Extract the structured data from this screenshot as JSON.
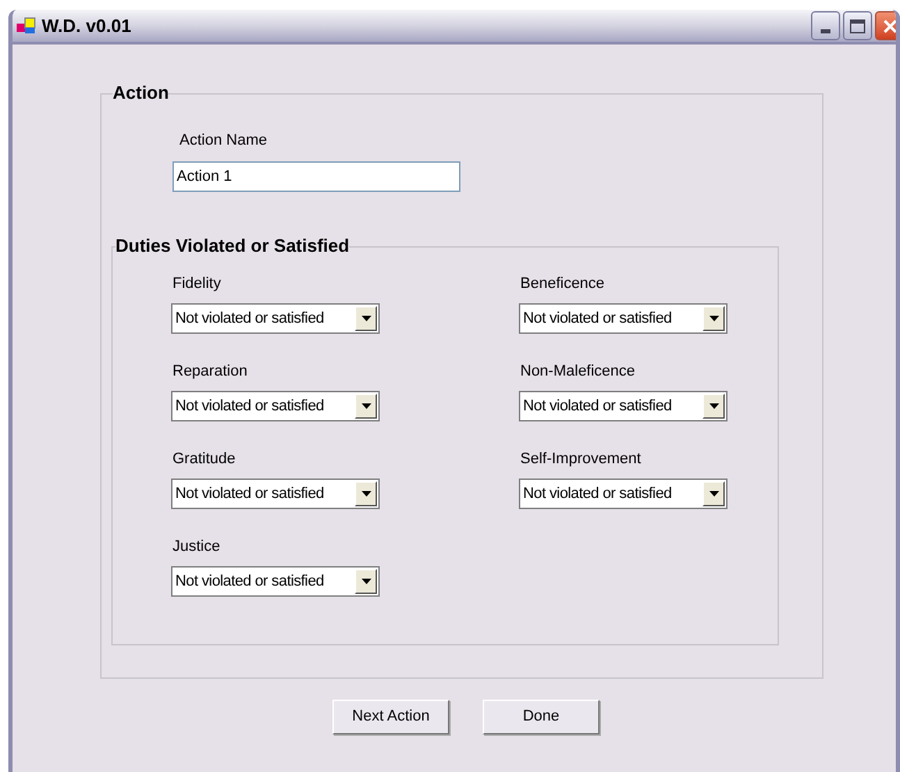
{
  "window": {
    "title": "W.D. v0.01"
  },
  "action_group": {
    "title": "Action",
    "name_label": "Action Name",
    "name_value": "Action 1"
  },
  "duties_group": {
    "title": "Duties Violated or Satisfied",
    "columns": [
      [
        {
          "label": "Fidelity",
          "value": "Not violated or satisfied"
        },
        {
          "label": "Reparation",
          "value": "Not violated or satisfied"
        },
        {
          "label": "Gratitude",
          "value": "Not violated or satisfied"
        },
        {
          "label": "Justice",
          "value": "Not violated or satisfied"
        }
      ],
      [
        {
          "label": "Beneficence",
          "value": "Not violated or satisfied"
        },
        {
          "label": "Non-Maleficence",
          "value": "Not violated or satisfied"
        },
        {
          "label": "Self-Improvement",
          "value": "Not violated or satisfied"
        }
      ]
    ]
  },
  "buttons": [
    "Next Action",
    "Done"
  ]
}
